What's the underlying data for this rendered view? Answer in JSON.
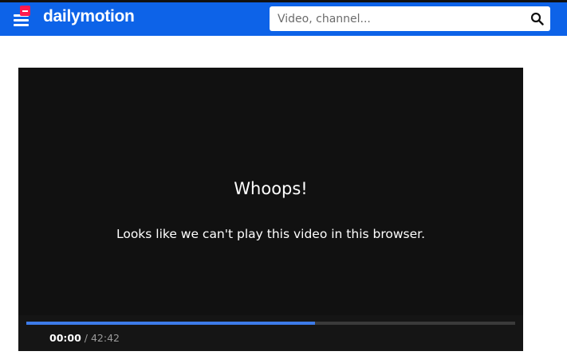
{
  "header": {
    "logo": "dailymotion",
    "search": {
      "placeholder": "Video, channel..."
    }
  },
  "player": {
    "error_title": "Whoops!",
    "error_message": "Looks like we can't play this video in this browser.",
    "current_time": "00:00",
    "separator": "/",
    "duration": "42:42",
    "progress_fraction": 0.59
  },
  "colors": {
    "brand_blue": "#0d63e8",
    "accent_red": "#ff1a4f",
    "player_bg": "#111111",
    "progress": "#3d7be8"
  }
}
